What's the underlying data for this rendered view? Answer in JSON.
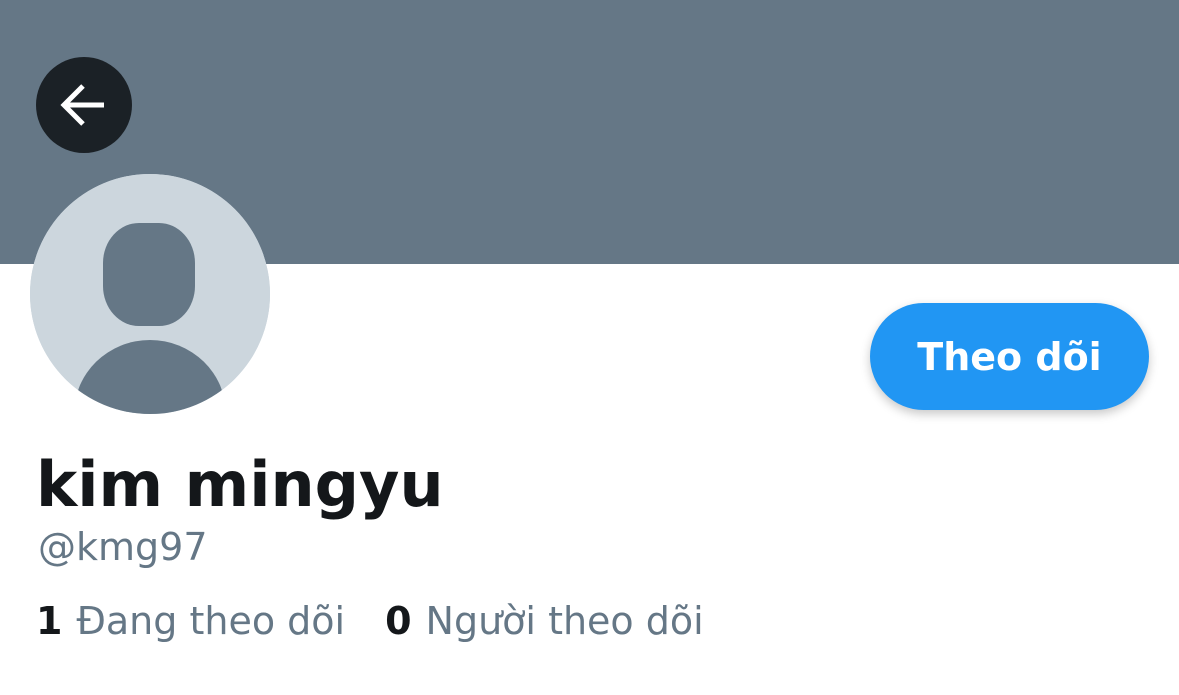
{
  "header": {
    "back_icon": "arrow-left-icon",
    "banner_color": "#657786"
  },
  "profile": {
    "avatar_icon": "default-avatar-icon",
    "display_name": "kim mingyu",
    "handle": "@kmg97"
  },
  "actions": {
    "follow_label": "Theo dõi",
    "follow_color": "#2196f3"
  },
  "stats": {
    "following_count": "1",
    "following_label": "Đang theo dõi",
    "followers_count": "0",
    "followers_label": "Người theo dõi"
  }
}
